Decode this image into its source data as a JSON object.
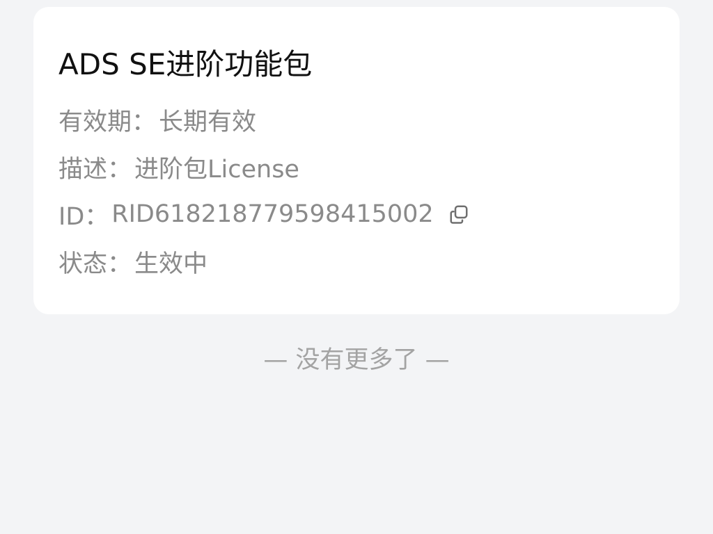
{
  "card": {
    "title": "ADS SE进阶功能包",
    "fields": [
      {
        "label": "有效期：",
        "value": "长期有效"
      },
      {
        "label": "描述：",
        "value": "进阶包License"
      },
      {
        "label": "ID：",
        "value": "RID618218779598415002"
      },
      {
        "label": "状态：",
        "value": "生效中"
      }
    ],
    "copy_icon": "copy-icon"
  },
  "footer": {
    "text": "— 没有更多了 —"
  },
  "colors": {
    "background": "#f3f4f6",
    "card": "#ffffff",
    "title": "#111111",
    "secondary_text": "#8a8a8a",
    "footer_text": "#a3a3a3"
  }
}
